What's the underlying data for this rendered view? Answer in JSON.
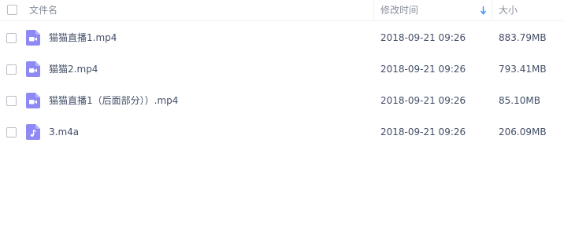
{
  "header": {
    "name_label": "文件名",
    "time_label": "修改时间",
    "size_label": "大小",
    "sort_icon": "arrow-down-icon"
  },
  "colors": {
    "icon_purple": "#8f89f5",
    "text": "#424e67",
    "header_text": "#888f9b",
    "sort_arrow": "#3b8cff"
  },
  "files": [
    {
      "name": "猫猫直播1.mp4",
      "modified": "2018-09-21 09:26",
      "size": "883.79MB",
      "icon": "video-file-icon"
    },
    {
      "name": "猫猫2.mp4",
      "modified": "2018-09-21 09:26",
      "size": "793.41MB",
      "icon": "video-file-icon"
    },
    {
      "name": "猫猫直播1（后面部分））.mp4",
      "modified": "2018-09-21 09:26",
      "size": "85.10MB",
      "icon": "video-file-icon"
    },
    {
      "name": "3.m4a",
      "modified": "2018-09-21 09:26",
      "size": "206.09MB",
      "icon": "audio-file-icon"
    }
  ]
}
